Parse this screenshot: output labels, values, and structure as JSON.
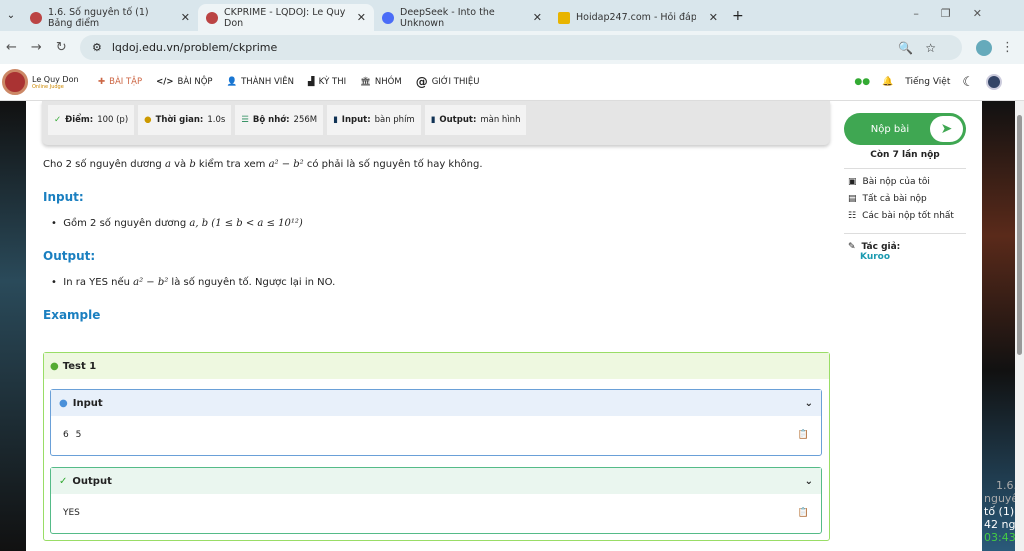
{
  "browser": {
    "tabs": [
      {
        "title": "1.6. Số nguyên tố (1) Bảng điểm",
        "color": "#b44"
      },
      {
        "title": "CKPRIME - LQDOJ: Le Quy Don",
        "color": "#b44"
      },
      {
        "title": "DeepSeek - Into the Unknown",
        "color": "#4a6cf7"
      },
      {
        "title": "Hoidap247.com - Hỏi đáp bài tập",
        "color": "#e8b400"
      }
    ],
    "url": "lqdoj.edu.vn/problem/ckprime"
  },
  "nav": {
    "logo_title": "Le Quy Don",
    "logo_sub": "Online Judge",
    "items": [
      "BÀI TẬP",
      "BÀI NỘP",
      "THÀNH VIÊN",
      "KỲ THI",
      "NHÓM",
      "GIỚI THIỆU"
    ],
    "language": "Tiếng Việt"
  },
  "info": [
    {
      "label": "Điểm:",
      "value": "100 (p)"
    },
    {
      "label": "Thời gian:",
      "value": "1.0s"
    },
    {
      "label": "Bộ nhớ:",
      "value": "256M"
    },
    {
      "label": "Input:",
      "value": "bàn phím"
    },
    {
      "label": "Output:",
      "value": "màn hình"
    }
  ],
  "statement": {
    "intro_1": "Cho 2 số nguyên dương ",
    "intro_2": " và ",
    "intro_3": " kiểm tra xem ",
    "intro_4": " có phải là số nguyên tố hay không.",
    "input_heading": "Input:",
    "input_text": "Gồm 2 số nguyên dương ",
    "input_math": "a, b (1 ≤ b < a ≤ 10¹²)",
    "output_heading": "Output:",
    "output_1": "In ra YES nếu ",
    "output_2": " là số nguyên tố. Ngược lại in NO.",
    "example_heading": "Example",
    "var_a": "a",
    "var_b": "b",
    "expr": "a² − b²"
  },
  "example": {
    "test_label": "Test 1",
    "input_label": "Input",
    "input_value": "6 5",
    "output_label": "Output",
    "output_value": "YES"
  },
  "sidebar": {
    "submit": "Nộp bài",
    "remaining": "Còn 7 lần nộp",
    "links": [
      "Bài nộp của tôi",
      "Tất cả bài nộp",
      "Các bài nộp tốt nhất"
    ],
    "author_label": "Tác giả:",
    "author": "Kuroo"
  },
  "overlay": {
    "lines": [
      "1.6.",
      "nguyê",
      "tố (1)",
      "42 ng",
      "03:43"
    ]
  }
}
